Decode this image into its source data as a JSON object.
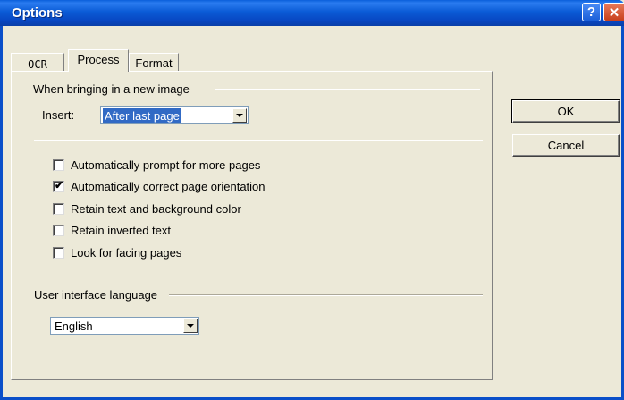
{
  "window": {
    "title": "Options"
  },
  "titlebar": {
    "help_glyph": "?",
    "close_glyph": "✕"
  },
  "tabs": [
    {
      "label": "OCR"
    },
    {
      "label": "Process"
    },
    {
      "label": "Format"
    }
  ],
  "selected_tab": "Process",
  "new_image_group": {
    "label": "When bringing in a new image",
    "insert_label": "Insert:",
    "insert_value": "After last page"
  },
  "options": [
    {
      "label": "Automatically prompt for more pages",
      "checked": false
    },
    {
      "label": "Automatically correct page orientation",
      "checked": true
    },
    {
      "label": "Retain text and background color",
      "checked": false
    },
    {
      "label": "Retain inverted text",
      "checked": false
    },
    {
      "label": "Look for facing pages",
      "checked": false
    }
  ],
  "language_group": {
    "label": "User interface language",
    "value": "English"
  },
  "buttons": {
    "ok": "OK",
    "cancel": "Cancel"
  },
  "check_glyph": "✔"
}
